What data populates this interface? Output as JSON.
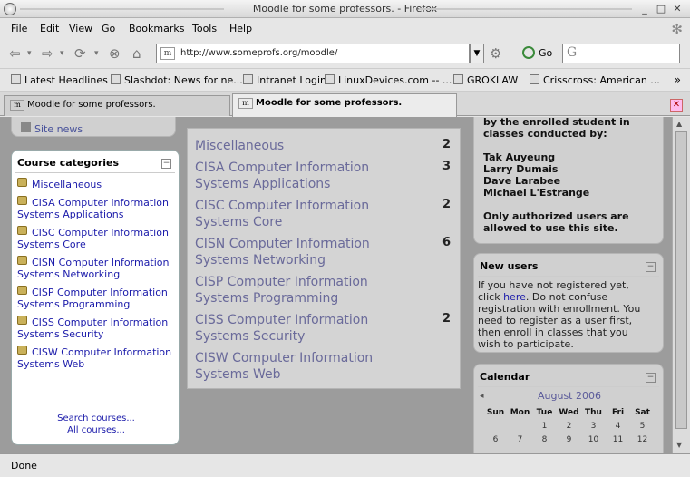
{
  "window": {
    "title": "Moodle for some professors. - Firefox"
  },
  "menu": [
    "File",
    "Edit",
    "View",
    "Go",
    "Bookmarks",
    "Tools",
    "Help"
  ],
  "navbar": {
    "url": "http://www.someprofs.org/moodle/",
    "go_label": "Go",
    "search_icon": "G"
  },
  "bookmarks": [
    "Latest Headlines",
    "Slashdot: News for ne...",
    "Intranet Login",
    "LinuxDevices.com -- ...",
    "GROKLAW",
    "Crisscross: American ..."
  ],
  "tabs": [
    {
      "label": "Moodle for some professors.",
      "active": false
    },
    {
      "label": "Moodle for some professors.",
      "active": true
    }
  ],
  "left": {
    "site_news": "Site news",
    "categories_title": "Course categories",
    "categories": [
      "Miscellaneous",
      "CISA Computer Information Systems Applications",
      "CISC Computer Information Systems Core",
      "CISN Computer Information Systems Networking",
      "CISP Computer Information Systems Programming",
      "CISS Computer Information Systems Security",
      "CISW Computer Information Systems Web"
    ],
    "search_courses": "Search courses...",
    "all_courses": "All courses..."
  },
  "main": {
    "courses": [
      {
        "name": "Miscellaneous",
        "count": "2"
      },
      {
        "name": "CISA Computer Information Systems Applications",
        "count": "3"
      },
      {
        "name": "CISC Computer Information Systems Core",
        "count": "2"
      },
      {
        "name": "CISN Computer Information Systems Networking",
        "count": "6"
      },
      {
        "name": "CISP Computer Information Systems Programming",
        "count": ""
      },
      {
        "name": "CISS Computer Information Systems Security",
        "count": "2"
      },
      {
        "name": "CISW Computer Information Systems Web",
        "count": ""
      }
    ]
  },
  "right": {
    "info_line1": "by the enrolled student in",
    "info_line2": "classes conducted by:",
    "teachers": [
      "Tak Auyeung",
      "Larry Dumais",
      "Dave Larabee",
      "Michael L'Estrange"
    ],
    "auth_line1": "Only authorized users are",
    "auth_line2": "allowed to use this site.",
    "new_users_title": "New users",
    "nu_line1": "If you have not registered yet,",
    "nu_click": "click",
    "nu_here": "here",
    "nu_line2_rest": ". Do not confuse",
    "nu_line3": "registration with enrollment. You",
    "nu_line4": "need to register as a user first,",
    "nu_line5": "then enroll in classes that you",
    "nu_line6": "wish to participate.",
    "calendar_title": "Calendar",
    "calendar_month": "August 2006",
    "calendar_days": [
      "Sun",
      "Mon",
      "Tue",
      "Wed",
      "Thu",
      "Fri",
      "Sat"
    ],
    "calendar_week1": [
      "",
      "",
      "1",
      "2",
      "3",
      "4",
      "5"
    ],
    "calendar_week2": [
      "6",
      "7",
      "8",
      "9",
      "10",
      "11",
      "12"
    ]
  },
  "status": "Done"
}
